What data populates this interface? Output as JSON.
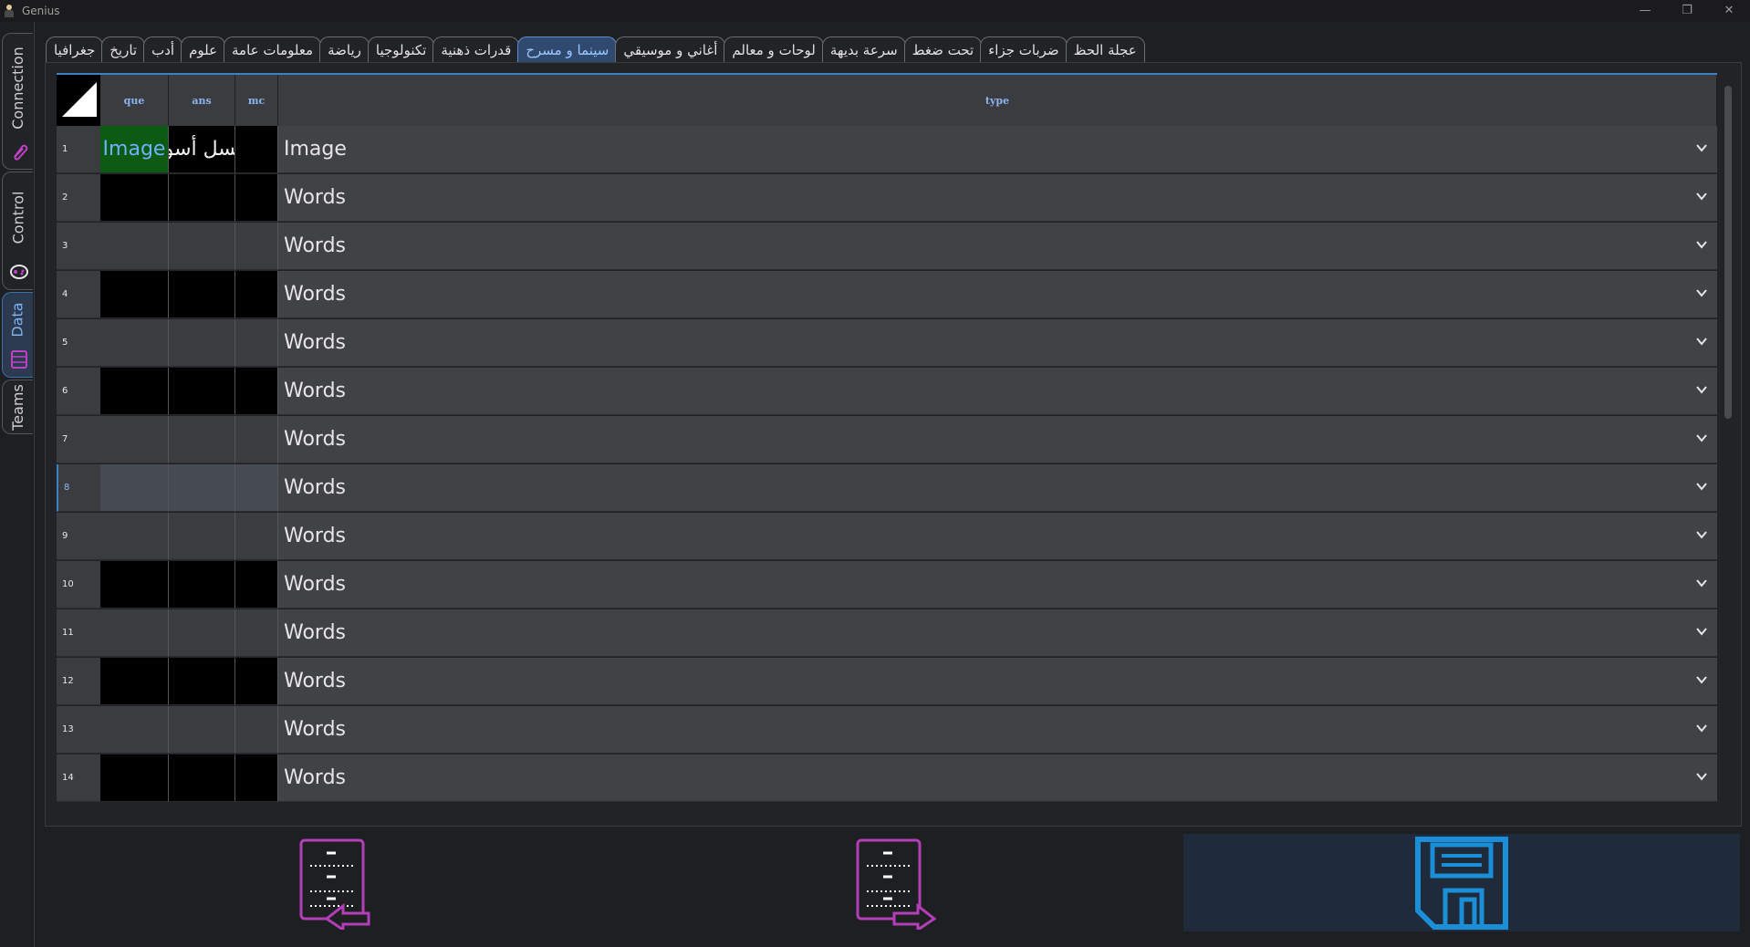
{
  "window": {
    "title": "Genius",
    "minimize": "—",
    "restore": "❐",
    "close": "✕"
  },
  "side_tabs": [
    {
      "label": "Connection",
      "icon": "paperclip-icon"
    },
    {
      "label": "Control",
      "icon": "gamepad-icon"
    },
    {
      "label": "Data",
      "icon": "database-icon"
    },
    {
      "label": "Teams",
      "icon": "people-icon"
    }
  ],
  "category_tabs": [
    "جغرافيا",
    "تاريخ",
    "أدب",
    "علوم",
    "معلومات عامة",
    "رياضة",
    "تكنولوجيا",
    "قدرات ذهنية",
    "سينما و مسرح",
    "أغاني و موسيقي",
    "لوحات و معالم",
    "سرعة بديهة",
    "تحت ضغط",
    "ضربات جزاء",
    "عجلة الحظ"
  ],
  "active_tab": "سينما و مسرح",
  "table": {
    "headers": {
      "que": "que",
      "ans": "ans",
      "mc": "mc",
      "type": "type"
    },
    "rows": [
      {
        "num": "1",
        "que": "Image",
        "ans": "عسل أسود",
        "type": "Image"
      },
      {
        "num": "2",
        "que": "",
        "ans": "",
        "type": "Words"
      },
      {
        "num": "3",
        "que": "",
        "ans": "",
        "type": "Words"
      },
      {
        "num": "4",
        "que": "",
        "ans": "",
        "type": "Words"
      },
      {
        "num": "5",
        "que": "",
        "ans": "",
        "type": "Words"
      },
      {
        "num": "6",
        "que": "",
        "ans": "",
        "type": "Words"
      },
      {
        "num": "7",
        "que": "",
        "ans": "",
        "type": "Words"
      },
      {
        "num": "8",
        "que": "",
        "ans": "",
        "type": "Words"
      },
      {
        "num": "9",
        "que": "",
        "ans": "",
        "type": "Words"
      },
      {
        "num": "10",
        "que": "",
        "ans": "",
        "type": "Words"
      },
      {
        "num": "11",
        "que": "",
        "ans": "",
        "type": "Words"
      },
      {
        "num": "12",
        "que": "",
        "ans": "",
        "type": "Words"
      },
      {
        "num": "13",
        "que": "",
        "ans": "",
        "type": "Words"
      },
      {
        "num": "14",
        "que": "",
        "ans": "",
        "type": "Words"
      }
    ],
    "selected_row": "8"
  },
  "bottom_buttons": [
    {
      "name": "import-button",
      "icon": "database-import-icon"
    },
    {
      "name": "export-button",
      "icon": "database-export-icon"
    },
    {
      "name": "save-button",
      "icon": "floppy-save-icon"
    }
  ],
  "colors": {
    "accent": "#3b82c4",
    "icon_magenta": "#b33fb8",
    "save_blue": "#1a8fd8",
    "image_cell": "#0d5a12"
  }
}
